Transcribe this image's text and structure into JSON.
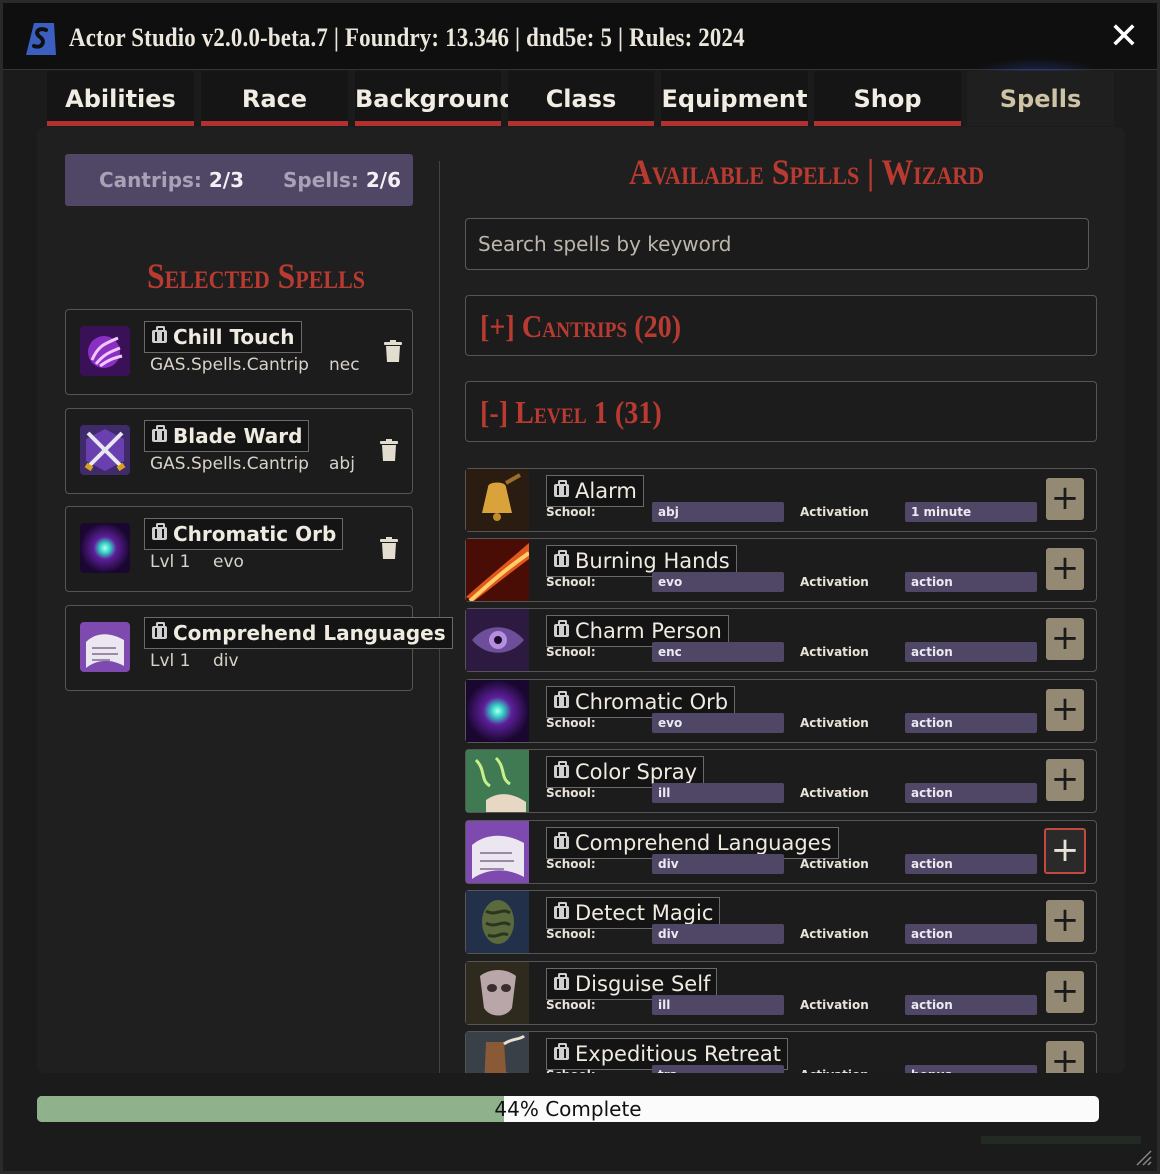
{
  "window": {
    "title": "Actor Studio v2.0.0-beta.7 | Foundry: 13.346 | dnd5e: 5 | Rules: 2024",
    "close_label": "✕"
  },
  "tabs": [
    {
      "label": "Abilities"
    },
    {
      "label": "Race"
    },
    {
      "label": "Background"
    },
    {
      "label": "Class"
    },
    {
      "label": "Equipment"
    },
    {
      "label": "Shop"
    },
    {
      "label": "Spells",
      "active": true
    }
  ],
  "counter": {
    "cantrips_label": "Cantrips:",
    "cantrips_value": "2/3",
    "spells_label": "Spells:",
    "spells_value": "2/6"
  },
  "selected": {
    "title": "Selected Spells",
    "items": [
      {
        "name": "Chill Touch",
        "line1": "GAS.Spells.Cantrip",
        "school": "nec",
        "icon": "chill-touch-icon"
      },
      {
        "name": "Blade Ward",
        "line1": "GAS.Spells.Cantrip",
        "school": "abj",
        "icon": "blade-ward-icon"
      },
      {
        "name": "Chromatic Orb",
        "line1": "Lvl 1",
        "school": "evo",
        "icon": "chromatic-orb-icon"
      },
      {
        "name": "Comprehend Languages",
        "line1": "Lvl 1",
        "school": "div",
        "icon": "comprehend-languages-icon"
      }
    ]
  },
  "available": {
    "title": "Available Spells | Wizard",
    "search_placeholder": "Search spells by keyword",
    "cantrips_header": "[+] Cantrips (20)",
    "level1_header": "[-] Level 1 (31)",
    "school_label": "School:",
    "activation_label": "Activation",
    "add_label": "+",
    "spells": [
      {
        "name": "Alarm",
        "school": "abj",
        "activation": "1 minute",
        "icon": "bell-icon"
      },
      {
        "name": "Burning Hands",
        "school": "evo",
        "activation": "action",
        "icon": "flame-icon"
      },
      {
        "name": "Charm Person",
        "school": "enc",
        "activation": "action",
        "icon": "eye-icon"
      },
      {
        "name": "Chromatic Orb",
        "school": "evo",
        "activation": "action",
        "icon": "orb-icon"
      },
      {
        "name": "Color Spray",
        "school": "ill",
        "activation": "action",
        "icon": "spray-icon"
      },
      {
        "name": "Comprehend Languages",
        "school": "div",
        "activation": "action",
        "icon": "scroll-icon"
      },
      {
        "name": "Detect Magic",
        "school": "div",
        "activation": "action",
        "icon": "rune-stone-icon"
      },
      {
        "name": "Disguise Self",
        "school": "ill",
        "activation": "action",
        "icon": "mask-icon"
      },
      {
        "name": "Expeditious Retreat",
        "school": "tra",
        "activation": "bonus",
        "icon": "boot-icon"
      }
    ]
  },
  "progress": {
    "value_percent": 44,
    "label": "44% Complete"
  },
  "colors": {
    "accent_red": "#b83a30",
    "pill_purple": "#4f4765",
    "button_tan": "#948a73",
    "progress_green": "#8fb18c"
  }
}
